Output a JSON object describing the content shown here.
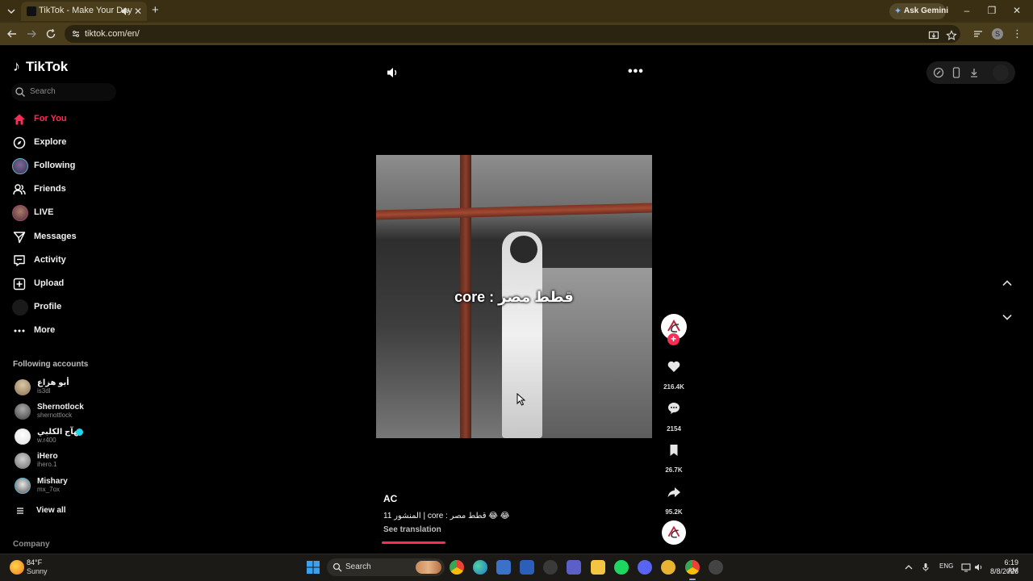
{
  "browser": {
    "tab_title": "TikTok - Make Your Day",
    "url": "tiktok.com/en/",
    "gemini_label": "Ask Gemini",
    "profile_initial": "S",
    "tab_close": "✕",
    "new_tab": "+",
    "window_minimize": "–",
    "window_restore": "❐",
    "window_close": "✕",
    "menu": "⋮"
  },
  "tiktok": {
    "logo": "TikTok",
    "logo_glyph": "♪",
    "search_placeholder": "Search",
    "nav": [
      {
        "label": "For You",
        "icon": "home-icon",
        "active": true
      },
      {
        "label": "Explore",
        "icon": "compass-icon"
      },
      {
        "label": "Following",
        "icon": "following-avatar"
      },
      {
        "label": "Friends",
        "icon": "friends-icon"
      },
      {
        "label": "LIVE",
        "icon": "live-avatar"
      },
      {
        "label": "Messages",
        "icon": "messages-icon"
      },
      {
        "label": "Activity",
        "icon": "activity-icon"
      },
      {
        "label": "Upload",
        "icon": "upload-icon"
      },
      {
        "label": "Profile",
        "icon": "profile-avatar"
      },
      {
        "label": "More",
        "icon": "more-icon"
      }
    ],
    "following_title": "Following accounts",
    "accounts": [
      {
        "name": "أبو هزاع",
        "handle": "is3dl"
      },
      {
        "name": "Shernotlock",
        "handle": "shernottlock"
      },
      {
        "name": "بهآج الكلبي",
        "handle": "w.r400",
        "verified": true
      },
      {
        "name": "iHero",
        "handle": "ihero.1"
      },
      {
        "name": "Mishary",
        "handle": "mx_7ox"
      }
    ],
    "view_all": "View all",
    "company": "Company"
  },
  "video": {
    "overlay_text": "core : قطط مصر",
    "author": "AC",
    "description": "المنشور 11 | core : قطط مصر 😂 😂",
    "see_translation": "See translation",
    "more_glyph": "•••",
    "follow_glyph": "+",
    "progress_fraction": 0.23,
    "likes": "216.4K",
    "comments": "2154",
    "saves": "26.7K",
    "shares": "95.2K"
  },
  "taskbar": {
    "weather_temp": "84°F",
    "weather_cond": "Sunny",
    "search_label": "Search",
    "lang": "ENG",
    "time": "6:19 AM",
    "date": "8/8/2026"
  },
  "colors": {
    "accent": "#fe2c55",
    "chrome_tab_bar": "#3a2f12",
    "chrome_toolbar": "#4a3d1c"
  }
}
